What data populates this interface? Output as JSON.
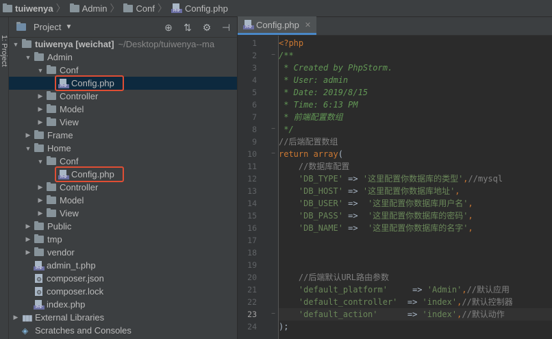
{
  "breadcrumb": [
    {
      "label": "tuiwenya",
      "icon": "folder-icon"
    },
    {
      "label": "Admin",
      "icon": "folder-icon"
    },
    {
      "label": "Conf",
      "icon": "folder-icon"
    },
    {
      "label": "Config.php",
      "icon": "php-file-icon"
    }
  ],
  "stripe": {
    "label": "1: Project"
  },
  "project_panel": {
    "title": "Project",
    "tools": [
      "crosshair-icon",
      "collapse-icon",
      "gear-icon",
      "hide-icon"
    ]
  },
  "tree": [
    {
      "label": "tuiwenya [weichat]",
      "suffix": "~/Desktop/tuiwenya--ma",
      "type": "folder",
      "depth": 0,
      "expanded": true
    },
    {
      "label": "Admin",
      "type": "folder",
      "depth": 1,
      "expanded": true
    },
    {
      "label": "Conf",
      "type": "folder",
      "depth": 2,
      "expanded": true
    },
    {
      "label": "Config.php",
      "type": "php",
      "depth": 3,
      "selected": true,
      "highlighted": true
    },
    {
      "label": "Controller",
      "type": "folder",
      "depth": 2,
      "expanded": false
    },
    {
      "label": "Model",
      "type": "folder",
      "depth": 2,
      "expanded": false
    },
    {
      "label": "View",
      "type": "folder",
      "depth": 2,
      "expanded": false
    },
    {
      "label": "Frame",
      "type": "folder",
      "depth": 1,
      "expanded": false
    },
    {
      "label": "Home",
      "type": "folder",
      "depth": 1,
      "expanded": true
    },
    {
      "label": "Conf",
      "type": "folder",
      "depth": 2,
      "expanded": true
    },
    {
      "label": "Config.php",
      "type": "php",
      "depth": 3,
      "highlighted": true
    },
    {
      "label": "Controller",
      "type": "folder",
      "depth": 2,
      "expanded": false
    },
    {
      "label": "Model",
      "type": "folder",
      "depth": 2,
      "expanded": false
    },
    {
      "label": "View",
      "type": "folder",
      "depth": 2,
      "expanded": false
    },
    {
      "label": "Public",
      "type": "folder",
      "depth": 1,
      "expanded": false
    },
    {
      "label": "tmp",
      "type": "folder",
      "depth": 1,
      "expanded": false
    },
    {
      "label": "vendor",
      "type": "folder",
      "depth": 1,
      "expanded": false
    },
    {
      "label": "admin_t.php",
      "type": "php",
      "depth": 1
    },
    {
      "label": "composer.json",
      "type": "json",
      "depth": 1
    },
    {
      "label": "composer.lock",
      "type": "json",
      "depth": 1
    },
    {
      "label": "index.php",
      "type": "php",
      "depth": 1
    },
    {
      "label": "External Libraries",
      "type": "libs",
      "depth": 0,
      "expanded": false
    },
    {
      "label": "Scratches and Consoles",
      "type": "scratch",
      "depth": 0
    }
  ],
  "editor": {
    "tab": {
      "label": "Config.php"
    },
    "current_line": 23,
    "lines": [
      [
        {
          "t": "<?php",
          "c": "php"
        }
      ],
      [
        {
          "t": "/**",
          "c": "doc"
        }
      ],
      [
        {
          "t": " * Created by PhpStorm.",
          "c": "doc"
        }
      ],
      [
        {
          "t": " * User: admin",
          "c": "doc"
        }
      ],
      [
        {
          "t": " * Date: 2019/8/15",
          "c": "doc"
        }
      ],
      [
        {
          "t": " * Time: 6:13 PM",
          "c": "doc"
        }
      ],
      [
        {
          "t": " * 前端配置数组",
          "c": "doc"
        }
      ],
      [
        {
          "t": " */",
          "c": "doc"
        }
      ],
      [
        {
          "t": "//后端配置数组",
          "c": "cm"
        }
      ],
      [
        {
          "t": "return ",
          "c": "kw"
        },
        {
          "t": "array",
          "c": "kw"
        },
        {
          "t": "(",
          "c": "pl"
        }
      ],
      [
        {
          "t": "    //数据库配置",
          "c": "cm"
        }
      ],
      [
        {
          "t": "    ",
          "c": "pl"
        },
        {
          "t": "'DB_TYPE'",
          "c": "str"
        },
        {
          "t": " => ",
          "c": "pl"
        },
        {
          "t": "'这里配置你数据库的类型'",
          "c": "str"
        },
        {
          "t": ",",
          "c": "kw"
        },
        {
          "t": "//mysql",
          "c": "cm"
        }
      ],
      [
        {
          "t": "    ",
          "c": "pl"
        },
        {
          "t": "'DB_HOST'",
          "c": "str"
        },
        {
          "t": " => ",
          "c": "pl"
        },
        {
          "t": "'这里配置你数据库地址'",
          "c": "str"
        },
        {
          "t": ",",
          "c": "kw"
        }
      ],
      [
        {
          "t": "    ",
          "c": "pl"
        },
        {
          "t": "'DB_USER'",
          "c": "str"
        },
        {
          "t": " =>  ",
          "c": "pl"
        },
        {
          "t": "'这里配置你数据库用户名'",
          "c": "str"
        },
        {
          "t": ",",
          "c": "kw"
        }
      ],
      [
        {
          "t": "    ",
          "c": "pl"
        },
        {
          "t": "'DB_PASS'",
          "c": "str"
        },
        {
          "t": " =>  ",
          "c": "pl"
        },
        {
          "t": "'这里配置你数据库的密码'",
          "c": "str"
        },
        {
          "t": ",",
          "c": "kw"
        }
      ],
      [
        {
          "t": "    ",
          "c": "pl"
        },
        {
          "t": "'DB_NAME'",
          "c": "str"
        },
        {
          "t": " =>  ",
          "c": "pl"
        },
        {
          "t": "'这里配置你数据库的名字'",
          "c": "str"
        },
        {
          "t": ",",
          "c": "kw"
        }
      ],
      [],
      [],
      [],
      [
        {
          "t": "    //后端默认URL路由参数",
          "c": "cm"
        }
      ],
      [
        {
          "t": "    ",
          "c": "pl"
        },
        {
          "t": "'default_platform'",
          "c": "str"
        },
        {
          "t": "     => ",
          "c": "pl"
        },
        {
          "t": "'Admin'",
          "c": "str"
        },
        {
          "t": ",",
          "c": "kw"
        },
        {
          "t": "//默认应用",
          "c": "cm"
        }
      ],
      [
        {
          "t": "    ",
          "c": "pl"
        },
        {
          "t": "'default_controller'",
          "c": "str"
        },
        {
          "t": "  => ",
          "c": "pl"
        },
        {
          "t": "'index'",
          "c": "str"
        },
        {
          "t": ",",
          "c": "kw"
        },
        {
          "t": "//默认控制器",
          "c": "cm"
        }
      ],
      [
        {
          "t": "    ",
          "c": "pl"
        },
        {
          "t": "'default_action'",
          "c": "str"
        },
        {
          "t": "      => ",
          "c": "pl"
        },
        {
          "t": "'index'",
          "c": "str"
        },
        {
          "t": ",",
          "c": "kw"
        },
        {
          "t": "//默认动作",
          "c": "cm"
        }
      ],
      [
        {
          "t": ");",
          "c": "pl"
        }
      ]
    ]
  }
}
